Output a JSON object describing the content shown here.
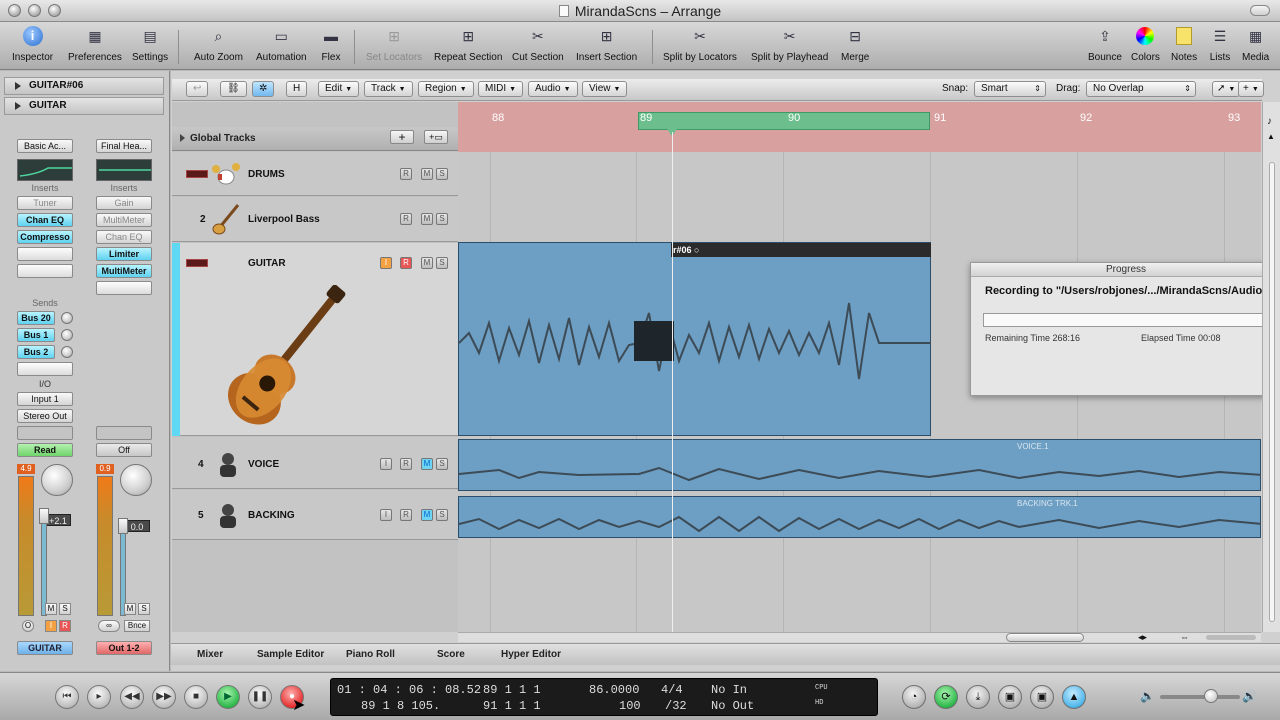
{
  "window": {
    "title": "MirandaScns – Arrange"
  },
  "toolbar": {
    "items": [
      {
        "label": "Inspector",
        "icon": "info-icon"
      },
      {
        "label": "Preferences",
        "icon": "preferences-icon"
      },
      {
        "label": "Settings",
        "icon": "settings-icon"
      },
      {
        "label": "Auto Zoom",
        "icon": "auto-zoom-icon"
      },
      {
        "label": "Automation",
        "icon": "automation-icon"
      },
      {
        "label": "Flex",
        "icon": "flex-icon"
      },
      {
        "label": "Set Locators",
        "icon": "set-locators-icon"
      },
      {
        "label": "Repeat Section",
        "icon": "repeat-section-icon"
      },
      {
        "label": "Cut Section",
        "icon": "cut-section-icon"
      },
      {
        "label": "Insert Section",
        "icon": "insert-section-icon"
      },
      {
        "label": "Split by Locators",
        "icon": "split-locators-icon"
      },
      {
        "label": "Split by Playhead",
        "icon": "split-playhead-icon"
      },
      {
        "label": "Merge",
        "icon": "merge-icon"
      },
      {
        "label": "Bounce",
        "icon": "bounce-icon"
      },
      {
        "label": "Colors",
        "icon": "colors-icon"
      },
      {
        "label": "Notes",
        "icon": "notes-icon"
      },
      {
        "label": "Lists",
        "icon": "lists-icon"
      },
      {
        "label": "Media",
        "icon": "media-icon"
      }
    ]
  },
  "inspector": {
    "region_row": "GUITAR#06",
    "track_row": "GUITAR",
    "strip1": {
      "setting": "Basic Ac...",
      "inserts_label": "Inserts",
      "plugins": [
        "Tuner",
        "Chan EQ",
        "Compresso",
        "",
        ""
      ],
      "sends_label": "Sends",
      "sends": [
        "Bus 20",
        "Bus 1",
        "Bus 2"
      ],
      "io_label": "I/O",
      "input": "Input 1",
      "output": "Stereo Out",
      "automation": "Read",
      "peak": "4.9",
      "volume": "+2.1",
      "bottom": [
        "M",
        "S"
      ],
      "bottom2": [
        "O",
        "I",
        "R"
      ],
      "name": "GUITAR"
    },
    "strip2": {
      "setting": "Final Hea...",
      "inserts_label": "Inserts",
      "plugins": [
        "Gain",
        "MultiMeter",
        "Chan EQ",
        "Limiter",
        "MultiMeter",
        ""
      ],
      "automation": "Off",
      "peak": "0.9",
      "volume": "0.0",
      "bottom": [
        "M",
        "S"
      ],
      "bottom2": [
        "∞",
        "Bnce"
      ],
      "name": "Out 1-2"
    }
  },
  "arrange_toolbar": {
    "menus": [
      "Edit",
      "Track",
      "Region",
      "MIDI",
      "Audio",
      "View"
    ],
    "snap_label": "Snap:",
    "snap_value": "Smart",
    "drag_label": "Drag:",
    "drag_value": "No Overlap",
    "h_button": "H"
  },
  "global_tracks": "Global Tracks",
  "tracks": [
    {
      "num": "",
      "name": "DRUMS",
      "icon": "drum-kit-icon"
    },
    {
      "num": "2",
      "name": "Liverpool Bass",
      "icon": "bass-guitar-icon"
    },
    {
      "num": "",
      "name": "GUITAR",
      "icon": "acoustic-guitar-icon"
    },
    {
      "num": "4",
      "name": "VOICE",
      "icon": "singer-icon"
    },
    {
      "num": "5",
      "name": "BACKING",
      "icon": "singer-icon"
    }
  ],
  "ruler": {
    "bars": [
      "88",
      "89",
      "90",
      "91",
      "92",
      "93"
    ]
  },
  "regions": {
    "guitar": "r#06",
    "voice": "VOICE.1",
    "backing": "BACKING TRK.1"
  },
  "progress": {
    "title": "Progress",
    "message": "Recording to \"/Users/robjones/.../MirandaScns/Audio Fil",
    "remaining": "Remaining Time 268:16",
    "elapsed": "Elapsed Time 00:08"
  },
  "bottom_tabs": [
    "Mixer",
    "Sample Editor",
    "Piano Roll",
    "Score",
    "Hyper Editor"
  ],
  "transport": {
    "smpte": "01 : 04 : 06 : 08.52",
    "bars": "89   1   1     1",
    "tempo": "86.0000",
    "sig": "4/4",
    "in": "No In",
    "smpte2": "89   1   8  105.",
    "bars2": "91   1   1     1",
    "div": "100",
    "div2": "/32",
    "out": "No Out",
    "cpu": "CPU",
    "hd": "HD"
  },
  "colors": {
    "cycle": "#6cbf8c",
    "region": "#6d9ec3",
    "record": "#e43030",
    "play": "#2db84a",
    "ruler": "#d9a0a0"
  }
}
